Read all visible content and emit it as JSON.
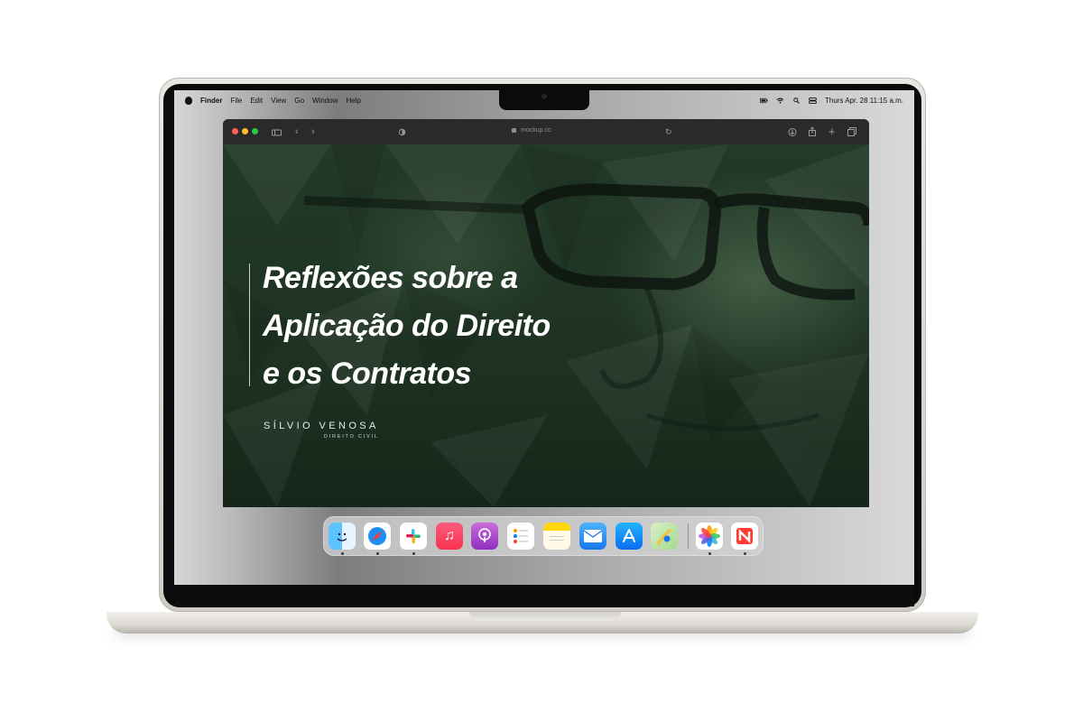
{
  "menubar": {
    "app_name": "Finder",
    "items": [
      "File",
      "Edit",
      "View",
      "Go",
      "Window",
      "Help"
    ],
    "datetime": "Thurs Apr. 28  11:15 a.m."
  },
  "browser": {
    "address": "mockup.co"
  },
  "hero": {
    "title_lines": [
      "Reflexões sobre a",
      "Aplicação do Direito",
      "e os Contratos"
    ],
    "brand_name": "SÍLVIO VENOSA",
    "brand_subtitle": "DIREITO CIVIL"
  },
  "colors": {
    "hero_bg": "#203525",
    "title": "#ffffff",
    "accent_green": "#28c840",
    "accent_red": "#ff5f57",
    "accent_yellow": "#febc2e"
  },
  "dock": {
    "apps": [
      {
        "name": "finder-icon",
        "running": true
      },
      {
        "name": "safari-icon",
        "running": true
      },
      {
        "name": "slack-icon",
        "running": true
      },
      {
        "name": "music-icon",
        "running": false
      },
      {
        "name": "podcasts-icon",
        "running": false
      },
      {
        "name": "reminders-icon",
        "running": false
      },
      {
        "name": "notes-icon",
        "running": false
      },
      {
        "name": "mail-icon",
        "running": false
      },
      {
        "name": "app-store-icon",
        "running": false
      },
      {
        "name": "maps-icon",
        "running": false
      },
      {
        "name": "photos-icon",
        "running": true
      },
      {
        "name": "news-icon",
        "running": true
      }
    ]
  }
}
